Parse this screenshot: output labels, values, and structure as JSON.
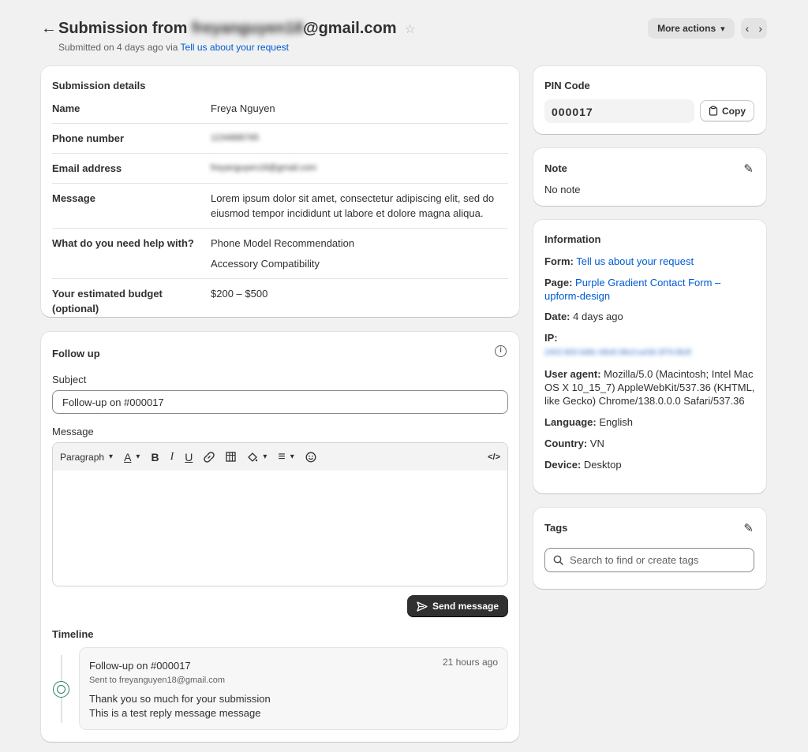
{
  "header": {
    "back": "←",
    "title_prefix": "Submission from ",
    "title_email_blurred": "freyanguyen18",
    "title_suffix": "@gmail.com",
    "star": "☆",
    "subtitle_prefix": "Submitted on 4 days ago via ",
    "subtitle_link": "Tell us about your request",
    "more_actions": "More actions",
    "chev_down": "⌵",
    "prev": "‹",
    "next": "›"
  },
  "details": {
    "title": "Submission details",
    "rows": [
      {
        "label": "Name",
        "value": "Freya Nguyen"
      },
      {
        "label": "Phone number",
        "value": "1234888765"
      },
      {
        "label": "Email address",
        "value": "freyanguyen18@gmail.com"
      },
      {
        "label": "Message",
        "value": "Lorem ipsum dolor sit amet, consectetur adipiscing elit, sed do eiusmod tempor incididunt ut labore et dolore magna aliqua."
      },
      {
        "label": "What do you need help with?",
        "value1": "Phone Model Recommendation",
        "value2": "Accessory Compatibility"
      },
      {
        "label": "Your estimated budget (optional)",
        "value": "$200 – $500"
      }
    ]
  },
  "follow": {
    "title": "Follow up",
    "info": "i",
    "subject_label": "Subject",
    "subject_value": "Follow-up on #000017",
    "message_label": "Message",
    "toolbar": {
      "paragraph": "Paragraph",
      "chev": "⌄",
      "font_color": "A̲",
      "bold": "B",
      "italic": "I",
      "underline": "U",
      "link": "🔗",
      "table": "▦",
      "fill": "◈",
      "align": "≡",
      "emoji": "☺",
      "code": "</>"
    },
    "send": "Send message",
    "send_icon": "➢"
  },
  "timeline": {
    "title": "Timeline",
    "entry": {
      "subject": "Follow-up on #000017",
      "time": "21 hours ago",
      "sent_to": "Sent to freyanguyen18@gmail.com",
      "line1": "Thank you so much for your submission",
      "line2": "This is a test reply message message"
    }
  },
  "pin": {
    "title": "PIN Code",
    "code": "000017",
    "copy": "Copy",
    "copy_icon": "📋"
  },
  "note": {
    "title": "Note",
    "value": "No note",
    "edit_icon": "✎"
  },
  "info": {
    "title": "Information",
    "form_label": "Form:",
    "form_value": "Tell us about your request",
    "page_label": "Page:",
    "page_value": "Purple Gradient Contact Form – upform-design",
    "date_label": "Date:",
    "date_value": "4 days ago",
    "ip_label": "IP:",
    "ip_value": "2402:800:6d8c:48e8:38e3:a436:3f76:8b3f",
    "ua_label": "User agent:",
    "ua_value": "Mozilla/5.0 (Macintosh; Intel Mac OS X 10_15_7) AppleWebKit/537.36 (KHTML, like Gecko) Chrome/138.0.0.0 Safari/537.36",
    "lang_label": "Language:",
    "lang_value": "English",
    "country_label": "Country:",
    "country_value": "VN",
    "device_label": "Device:",
    "device_value": "Desktop"
  },
  "tags": {
    "title": "Tags",
    "edit_icon": "✎",
    "search_icon": "⌕",
    "placeholder": "Search to find or create tags"
  }
}
